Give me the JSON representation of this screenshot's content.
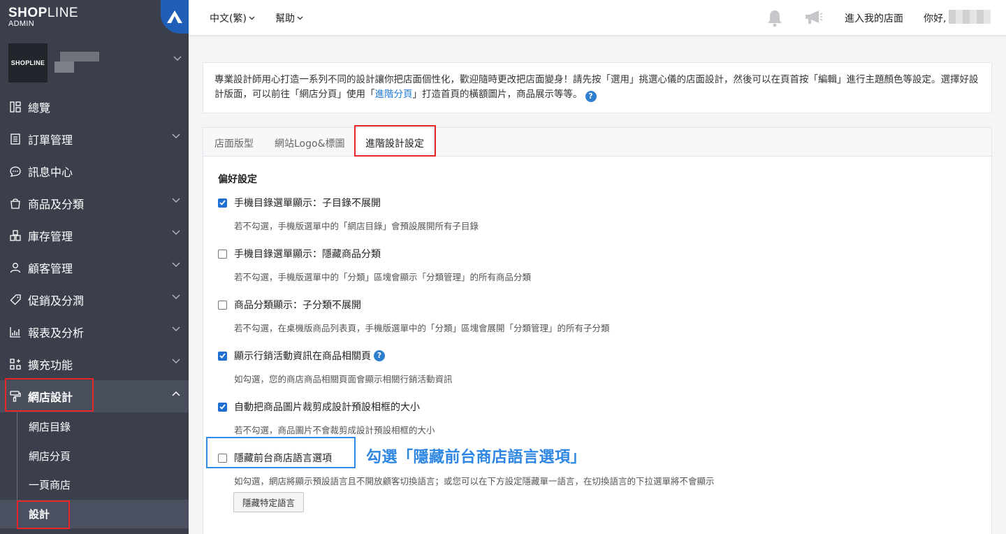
{
  "brand": {
    "name_bold": "SHOP",
    "name_thin": "LINE",
    "sub": "ADMIN"
  },
  "store": {
    "avatar_text": "SHOPLINE"
  },
  "sidebar": {
    "items": [
      {
        "label": "總覽",
        "icon": "grid-icon",
        "has_chevron": false
      },
      {
        "label": "訂單管理",
        "icon": "order-list-icon",
        "has_chevron": true
      },
      {
        "label": "訊息中心",
        "icon": "chat-bubble-icon",
        "has_chevron": false
      },
      {
        "label": "商品及分類",
        "icon": "shopping-bag-icon",
        "has_chevron": true
      },
      {
        "label": "庫存管理",
        "icon": "boxes-icon",
        "has_chevron": true
      },
      {
        "label": "顧客管理",
        "icon": "person-icon",
        "has_chevron": true
      },
      {
        "label": "促銷及分潤",
        "icon": "tag-icon",
        "has_chevron": true
      },
      {
        "label": "報表及分析",
        "icon": "bar-chart-icon",
        "has_chevron": true
      },
      {
        "label": "擴充功能",
        "icon": "apps-icon",
        "has_chevron": true
      },
      {
        "label": "網店設計",
        "icon": "paint-roller-icon",
        "has_chevron": true,
        "expanded": true
      }
    ],
    "sub_items": [
      {
        "label": "網店目錄"
      },
      {
        "label": "網店分頁"
      },
      {
        "label": "一頁商店"
      },
      {
        "label": "設計"
      }
    ]
  },
  "topbar": {
    "language": "中文(繁)",
    "help": "幫助",
    "enter_store": "進入我的店面",
    "greeting": "你好,"
  },
  "notice": {
    "text_before": "專業設計師用心打造一系列不同的設計讓你把店面個性化，歡迎隨時更改把店面變身！請先按「選用」挑選心儀的店面設計，然後可以在頁首按「編輯」進行主題顏色等設定。選擇好設計版面，可以前往「網店分頁」使用「",
    "link": "進階分頁",
    "text_after": "」打造首頁的橫額圖片，商品展示等等。"
  },
  "tabs": [
    {
      "label": "店面版型"
    },
    {
      "label": "網站Logo&標圖"
    },
    {
      "label": "進階設計設定",
      "active": true
    }
  ],
  "preferences": {
    "title": "偏好設定",
    "options": [
      {
        "label": "手機目錄選單顯示：子目錄不展開",
        "checked": true,
        "desc": "若不勾選，手機版選單中的「網店目錄」會預設展開所有子目錄"
      },
      {
        "label": "手機目錄選單顯示：隱藏商品分類",
        "checked": false,
        "desc": "若不勾選，手機版選單中的「分類」區塊會顯示「分類管理」的所有商品分類"
      },
      {
        "label": "商品分類顯示：子分類不展開",
        "checked": false,
        "desc": "若不勾選，在桌機版商品列表頁，手機版選單中的「分類」區塊會展開「分類管理」的所有子分類"
      },
      {
        "label": "顯示行銷活動資訊在商品相關頁",
        "checked": true,
        "desc": "如勾選，您的商店商品相關頁面會顯示相關行銷活動資訊",
        "help": true
      },
      {
        "label": "自動把商品圖片裁剪成設計預設相框的大小",
        "checked": true,
        "desc": "若不勾選，商品圖片不會裁剪成設計預設相框的大小"
      },
      {
        "label": "隱藏前台商店語言選項",
        "checked": false,
        "desc": "如勾選，網店將顯示預設語言且不開放顧客切換語言；或您可以在下方設定隱藏單一語言，在切換語言的下拉選單將不會顯示"
      }
    ],
    "hide_language_button": "隱藏特定語言"
  },
  "callout": "勾選「隱藏前台商店語言選項」",
  "colors": {
    "sidebar_bg": "#3a3f4b",
    "accent": "#1f6fd0",
    "highlight_red": "#e8262a",
    "callout_blue": "#2e86e3"
  }
}
